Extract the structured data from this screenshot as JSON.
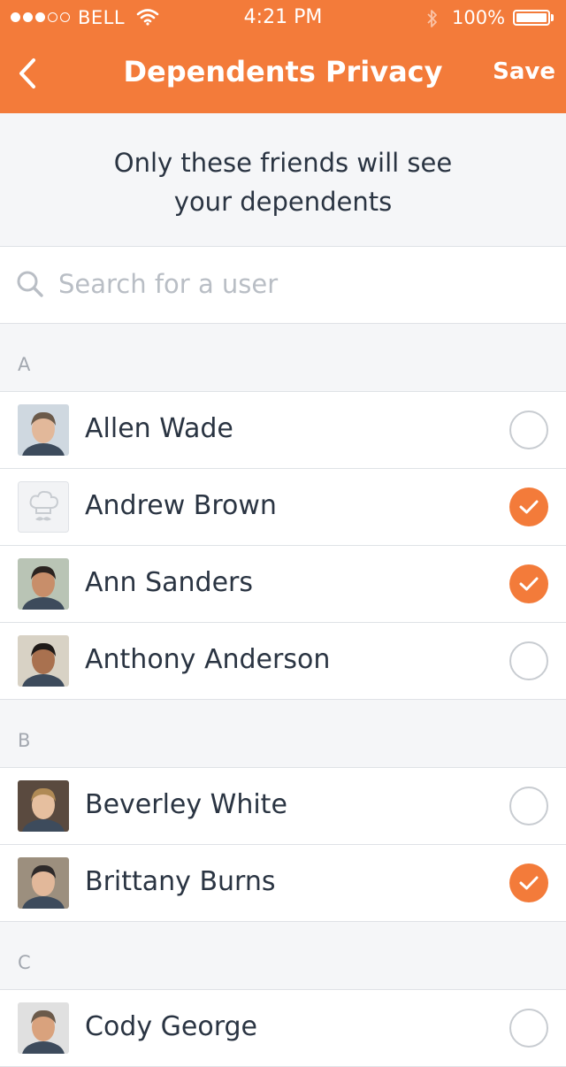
{
  "status": {
    "carrier": "BELL",
    "time": "4:21 PM",
    "battery": "100%",
    "signal_bars": 3,
    "signal_total": 5
  },
  "nav": {
    "title": "Dependents Privacy",
    "save_label": "Save",
    "back_icon": "chevron-left-icon"
  },
  "intro": {
    "line1": "Only these friends will see",
    "line2": "your dependents"
  },
  "search": {
    "placeholder": "Search for a user",
    "value": ""
  },
  "colors": {
    "accent": "#f37b3a",
    "text": "#2a3442",
    "muted": "#a3a8b0"
  },
  "sections": [
    {
      "letter": "A",
      "users": [
        {
          "name": "Allen Wade",
          "selected": false,
          "avatar": "photo"
        },
        {
          "name": "Andrew Brown",
          "selected": true,
          "avatar": "chef-hat-placeholder"
        },
        {
          "name": "Ann Sanders",
          "selected": true,
          "avatar": "photo"
        },
        {
          "name": "Anthony Anderson",
          "selected": false,
          "avatar": "photo"
        }
      ]
    },
    {
      "letter": "B",
      "users": [
        {
          "name": "Beverley White",
          "selected": false,
          "avatar": "photo"
        },
        {
          "name": "Brittany Burns",
          "selected": true,
          "avatar": "photo"
        }
      ]
    },
    {
      "letter": "C",
      "users": [
        {
          "name": "Cody George",
          "selected": false,
          "avatar": "photo"
        }
      ]
    }
  ]
}
